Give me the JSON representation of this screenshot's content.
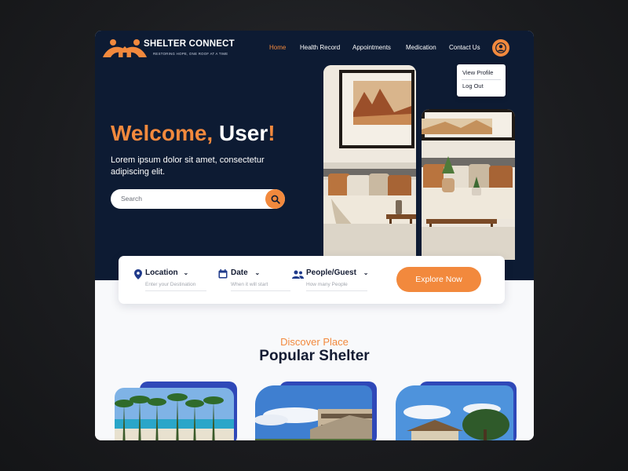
{
  "brand": {
    "name": "SHELTER CONNECT",
    "tagline": "RESTORING HOPE, ONE ROOF AT A TIME"
  },
  "nav": {
    "items": [
      {
        "label": "Home",
        "active": true
      },
      {
        "label": "Health Record",
        "active": false
      },
      {
        "label": "Appointments",
        "active": false
      },
      {
        "label": "Medication",
        "active": false
      },
      {
        "label": "Contact Us",
        "active": false
      }
    ]
  },
  "user_menu": {
    "icon": "user-avatar-icon",
    "items": [
      "View Profile",
      "Log Out"
    ]
  },
  "hero": {
    "welcome_prefix": "Welcome,",
    "welcome_user": "User",
    "welcome_suffix": "!",
    "description": "Lorem ipsum dolor sit amet, consectetur adipiscing elit.",
    "search_placeholder": "Search"
  },
  "booking": {
    "fields": [
      {
        "label": "Location",
        "hint": "Enter your Destination",
        "icon": "location-pin-icon"
      },
      {
        "label": "Date",
        "hint": "When it will start",
        "icon": "calendar-icon"
      },
      {
        "label": "People/Guest",
        "hint": "How many People",
        "icon": "people-icon"
      }
    ],
    "cta": "Explore Now"
  },
  "section": {
    "kicker": "Discover Place",
    "title": "Popular Shelter"
  },
  "colors": {
    "accent": "#f2893d",
    "navy": "#0d1b33",
    "card_blue": "#2f48b8"
  }
}
